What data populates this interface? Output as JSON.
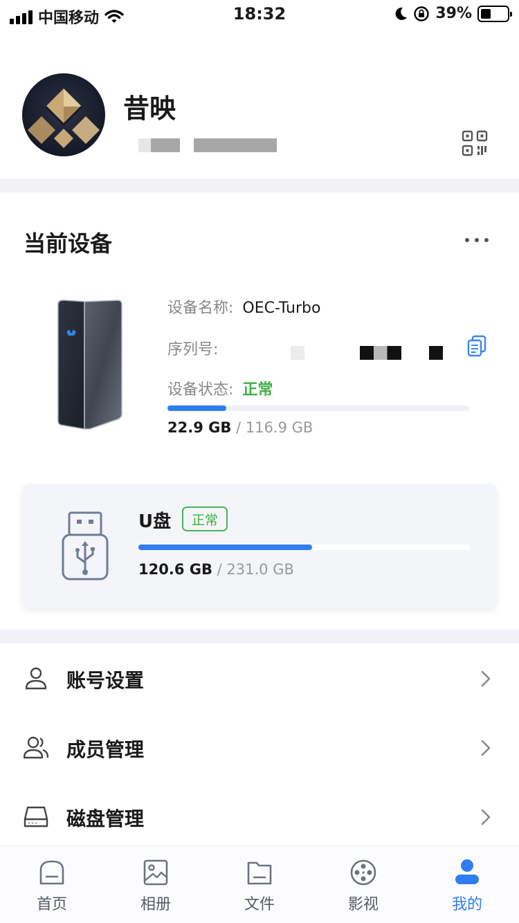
{
  "status_bar": {
    "carrier": "中国移动",
    "time": "18:32",
    "battery_percent": "39%",
    "battery_level": 0.39
  },
  "profile": {
    "name": "昔映"
  },
  "device_section": {
    "title": "当前设备",
    "name_label": "设备名称:",
    "name_value": "OEC-Turbo",
    "serial_label": "序列号:",
    "status_label": "设备状态:",
    "status_value": "正常",
    "storage_used": "22.9 GB",
    "storage_sep": " / ",
    "storage_total": "116.9 GB",
    "storage_fraction": 0.196
  },
  "usb": {
    "title": "U盘",
    "badge": "正常",
    "storage_used": "120.6 GB",
    "storage_sep": " / ",
    "storage_total": "231.0 GB",
    "storage_fraction": 0.522
  },
  "menu": {
    "items": [
      {
        "label": "账号设置",
        "icon": "user-icon"
      },
      {
        "label": "成员管理",
        "icon": "members-icon"
      },
      {
        "label": "磁盘管理",
        "icon": "disk-icon"
      }
    ]
  },
  "tabs": [
    {
      "label": "首页",
      "icon": "home-icon"
    },
    {
      "label": "相册",
      "icon": "album-icon"
    },
    {
      "label": "文件",
      "icon": "folder-icon"
    },
    {
      "label": "影视",
      "icon": "film-reel-icon"
    },
    {
      "label": "我的",
      "icon": "profile-icon",
      "active": true
    }
  ],
  "colors": {
    "accent_blue": "#2e7ef0",
    "status_green": "#3cb043",
    "divider_band": "#f2f1f6"
  }
}
